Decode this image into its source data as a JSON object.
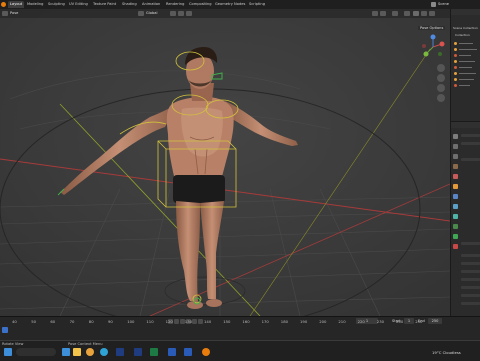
{
  "menu_tabs": [
    "Layout",
    "Modeling",
    "Sculpting",
    "UV Editing",
    "Texture Paint",
    "Shading",
    "Animation",
    "Rendering",
    "Compositing",
    "Geometry Nodes",
    "Scripting"
  ],
  "scene": {
    "label": "Scene"
  },
  "viewport_header": {
    "mode": "Pose",
    "orientation": "Global",
    "pose_options": "Pose Options"
  },
  "outliner": {
    "title": "Scene Collection",
    "item": "Collection"
  },
  "timeline": {
    "ticks": [
      "40",
      "50",
      "60",
      "70",
      "80",
      "90",
      "100",
      "110",
      "120",
      "130",
      "140",
      "150",
      "160",
      "170",
      "180",
      "190",
      "200",
      "210",
      "220",
      "230",
      "240",
      "250"
    ],
    "current_frame": "1",
    "start_label": "Start",
    "start_value": "1",
    "end_label": "End",
    "end_value": "250"
  },
  "status_bar": {
    "left": "Rotate View",
    "middle": "Pose Context Menu"
  },
  "taskbar": {
    "weather": "19°C Cloudless",
    "colors": {
      "windows": "#3c8fd8",
      "explorer": "#f3c34a",
      "chrome": "#e9a33c",
      "edge": "#2fa3d6",
      "photoshop": "#1f3c80",
      "excel": "#1e7a45",
      "word": "#2b5bb8",
      "blender": "#e87d0d"
    }
  }
}
